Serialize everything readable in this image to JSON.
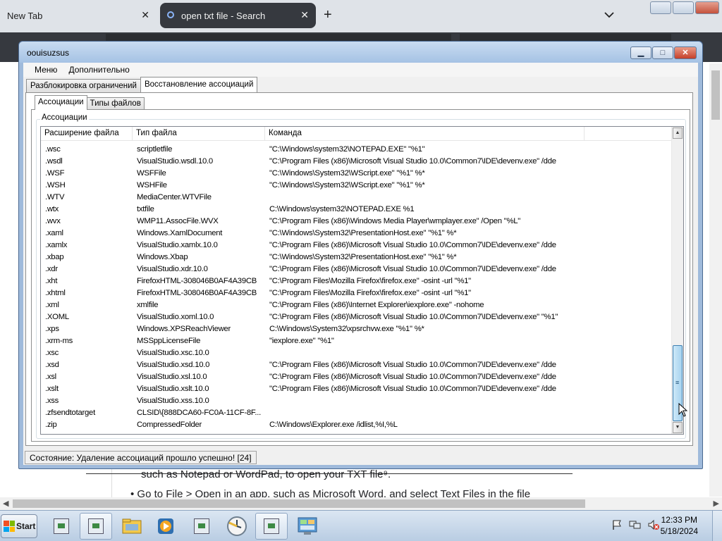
{
  "browser": {
    "tabs": [
      {
        "label": "New Tab",
        "active": false
      },
      {
        "label": "open txt file - Search",
        "active": true
      }
    ],
    "new_tab_symbol": "+",
    "close_symbol": "✕",
    "page_text": {
      "line1": "such as Notepad or WordPad, to open your TXT file",
      "line1_suffix": "⁹.",
      "line2": "• Go to File > Open in an app, such as Microsoft Word, and select Text Files in the file"
    }
  },
  "app": {
    "title": "oouisuzsus",
    "menu": [
      "Меню",
      "Дополнительно"
    ],
    "outer_tabs": [
      "Разблокировка ограничений",
      "Восстановление ассоциаций"
    ],
    "outer_active": 1,
    "inner_tabs": [
      "Ассоциации",
      "Типы файлов"
    ],
    "inner_active": 0,
    "group_label": "Ассоциации",
    "columns": [
      "Расширение файла",
      "Тип файла",
      "Команда"
    ],
    "rows": [
      [
        ".wsc",
        "scriptletfile",
        "\"C:\\Windows\\system32\\NOTEPAD.EXE\" \"%1\""
      ],
      [
        ".wsdl",
        "VisualStudio.wsdl.10.0",
        "\"C:\\Program Files (x86)\\Microsoft Visual Studio 10.0\\Common7\\IDE\\devenv.exe\" /dde"
      ],
      [
        ".WSF",
        "WSFFile",
        "\"C:\\Windows\\System32\\WScript.exe\" \"%1\" %*"
      ],
      [
        ".WSH",
        "WSHFile",
        "\"C:\\Windows\\System32\\WScript.exe\" \"%1\" %*"
      ],
      [
        ".WTV",
        "MediaCenter.WTVFile",
        ""
      ],
      [
        ".wtx",
        "txtfile",
        "C:\\Windows\\system32\\NOTEPAD.EXE %1"
      ],
      [
        ".wvx",
        "WMP11.AssocFile.WVX",
        "\"C:\\Program Files (x86)\\Windows Media Player\\wmplayer.exe\" /Open \"%L\""
      ],
      [
        ".xaml",
        "Windows.XamlDocument",
        "\"C:\\Windows\\System32\\PresentationHost.exe\" \"%1\" %*"
      ],
      [
        ".xamlx",
        "VisualStudio.xamlx.10.0",
        "\"C:\\Program Files (x86)\\Microsoft Visual Studio 10.0\\Common7\\IDE\\devenv.exe\" /dde"
      ],
      [
        ".xbap",
        "Windows.Xbap",
        "\"C:\\Windows\\System32\\PresentationHost.exe\" \"%1\" %*"
      ],
      [
        ".xdr",
        "VisualStudio.xdr.10.0",
        "\"C:\\Program Files (x86)\\Microsoft Visual Studio 10.0\\Common7\\IDE\\devenv.exe\" /dde"
      ],
      [
        ".xht",
        "FirefoxHTML-308046B0AF4A39CB",
        "\"C:\\Program Files\\Mozilla Firefox\\firefox.exe\" -osint -url \"%1\""
      ],
      [
        ".xhtml",
        "FirefoxHTML-308046B0AF4A39CB",
        "\"C:\\Program Files\\Mozilla Firefox\\firefox.exe\" -osint -url \"%1\""
      ],
      [
        ".xml",
        "xmlfile",
        "\"C:\\Program Files (x86)\\Internet Explorer\\iexplore.exe\" -nohome"
      ],
      [
        ".XOML",
        "VisualStudio.xoml.10.0",
        "\"C:\\Program Files (x86)\\Microsoft Visual Studio 10.0\\Common7\\IDE\\devenv.exe\" \"%1\""
      ],
      [
        ".xps",
        "Windows.XPSReachViewer",
        "C:\\Windows\\System32\\xpsrchvw.exe \"%1\" %*"
      ],
      [
        ".xrm-ms",
        "MSSppLicenseFile",
        "\"iexplore.exe\" \"%1\""
      ],
      [
        ".xsc",
        "VisualStudio.xsc.10.0",
        ""
      ],
      [
        ".xsd",
        "VisualStudio.xsd.10.0",
        "\"C:\\Program Files (x86)\\Microsoft Visual Studio 10.0\\Common7\\IDE\\devenv.exe\" /dde"
      ],
      [
        ".xsl",
        "VisualStudio.xsl.10.0",
        "\"C:\\Program Files (x86)\\Microsoft Visual Studio 10.0\\Common7\\IDE\\devenv.exe\" /dde"
      ],
      [
        ".xslt",
        "VisualStudio.xslt.10.0",
        "\"C:\\Program Files (x86)\\Microsoft Visual Studio 10.0\\Common7\\IDE\\devenv.exe\" /dde"
      ],
      [
        ".xss",
        "VisualStudio.xss.10.0",
        ""
      ],
      [
        ".zfsendtotarget",
        "CLSID\\{888DCA60-FC0A-11CF-8F...",
        ""
      ],
      [
        ".zip",
        "CompressedFolder",
        "C:\\Windows\\Explorer.exe /idlist,%I,%L"
      ]
    ],
    "status": "Состояние: Удаление ассоциаций прошло успешно! [24]"
  },
  "taskbar": {
    "start_label": "Start",
    "time": "12:33 PM",
    "date": "5/18/2024"
  },
  "colors": {
    "browser_tab_active": "#36393f",
    "window_frame": "#9fbadb",
    "scroll_thumb": "#a7d3ef",
    "close_button": "#c4402a"
  }
}
